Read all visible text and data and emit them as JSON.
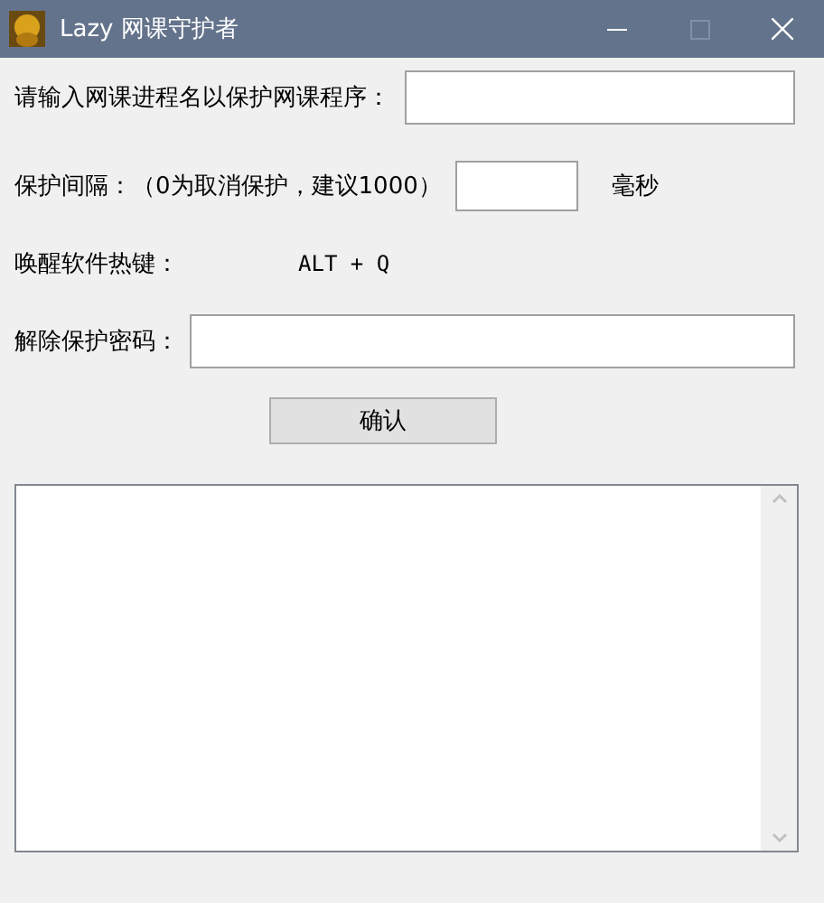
{
  "window": {
    "title": "Lazy 网课守护者"
  },
  "process_name": {
    "label": "请输入网课进程名以保护网课程序："
  },
  "interval": {
    "label": "保护间隔：（0为取消保护，建议1000）",
    "unit": "毫秒"
  },
  "hotkey": {
    "label": "唤醒软件热键：",
    "value": "ALT + Q"
  },
  "password": {
    "label": "解除保护密码："
  },
  "confirm_button": "确认"
}
